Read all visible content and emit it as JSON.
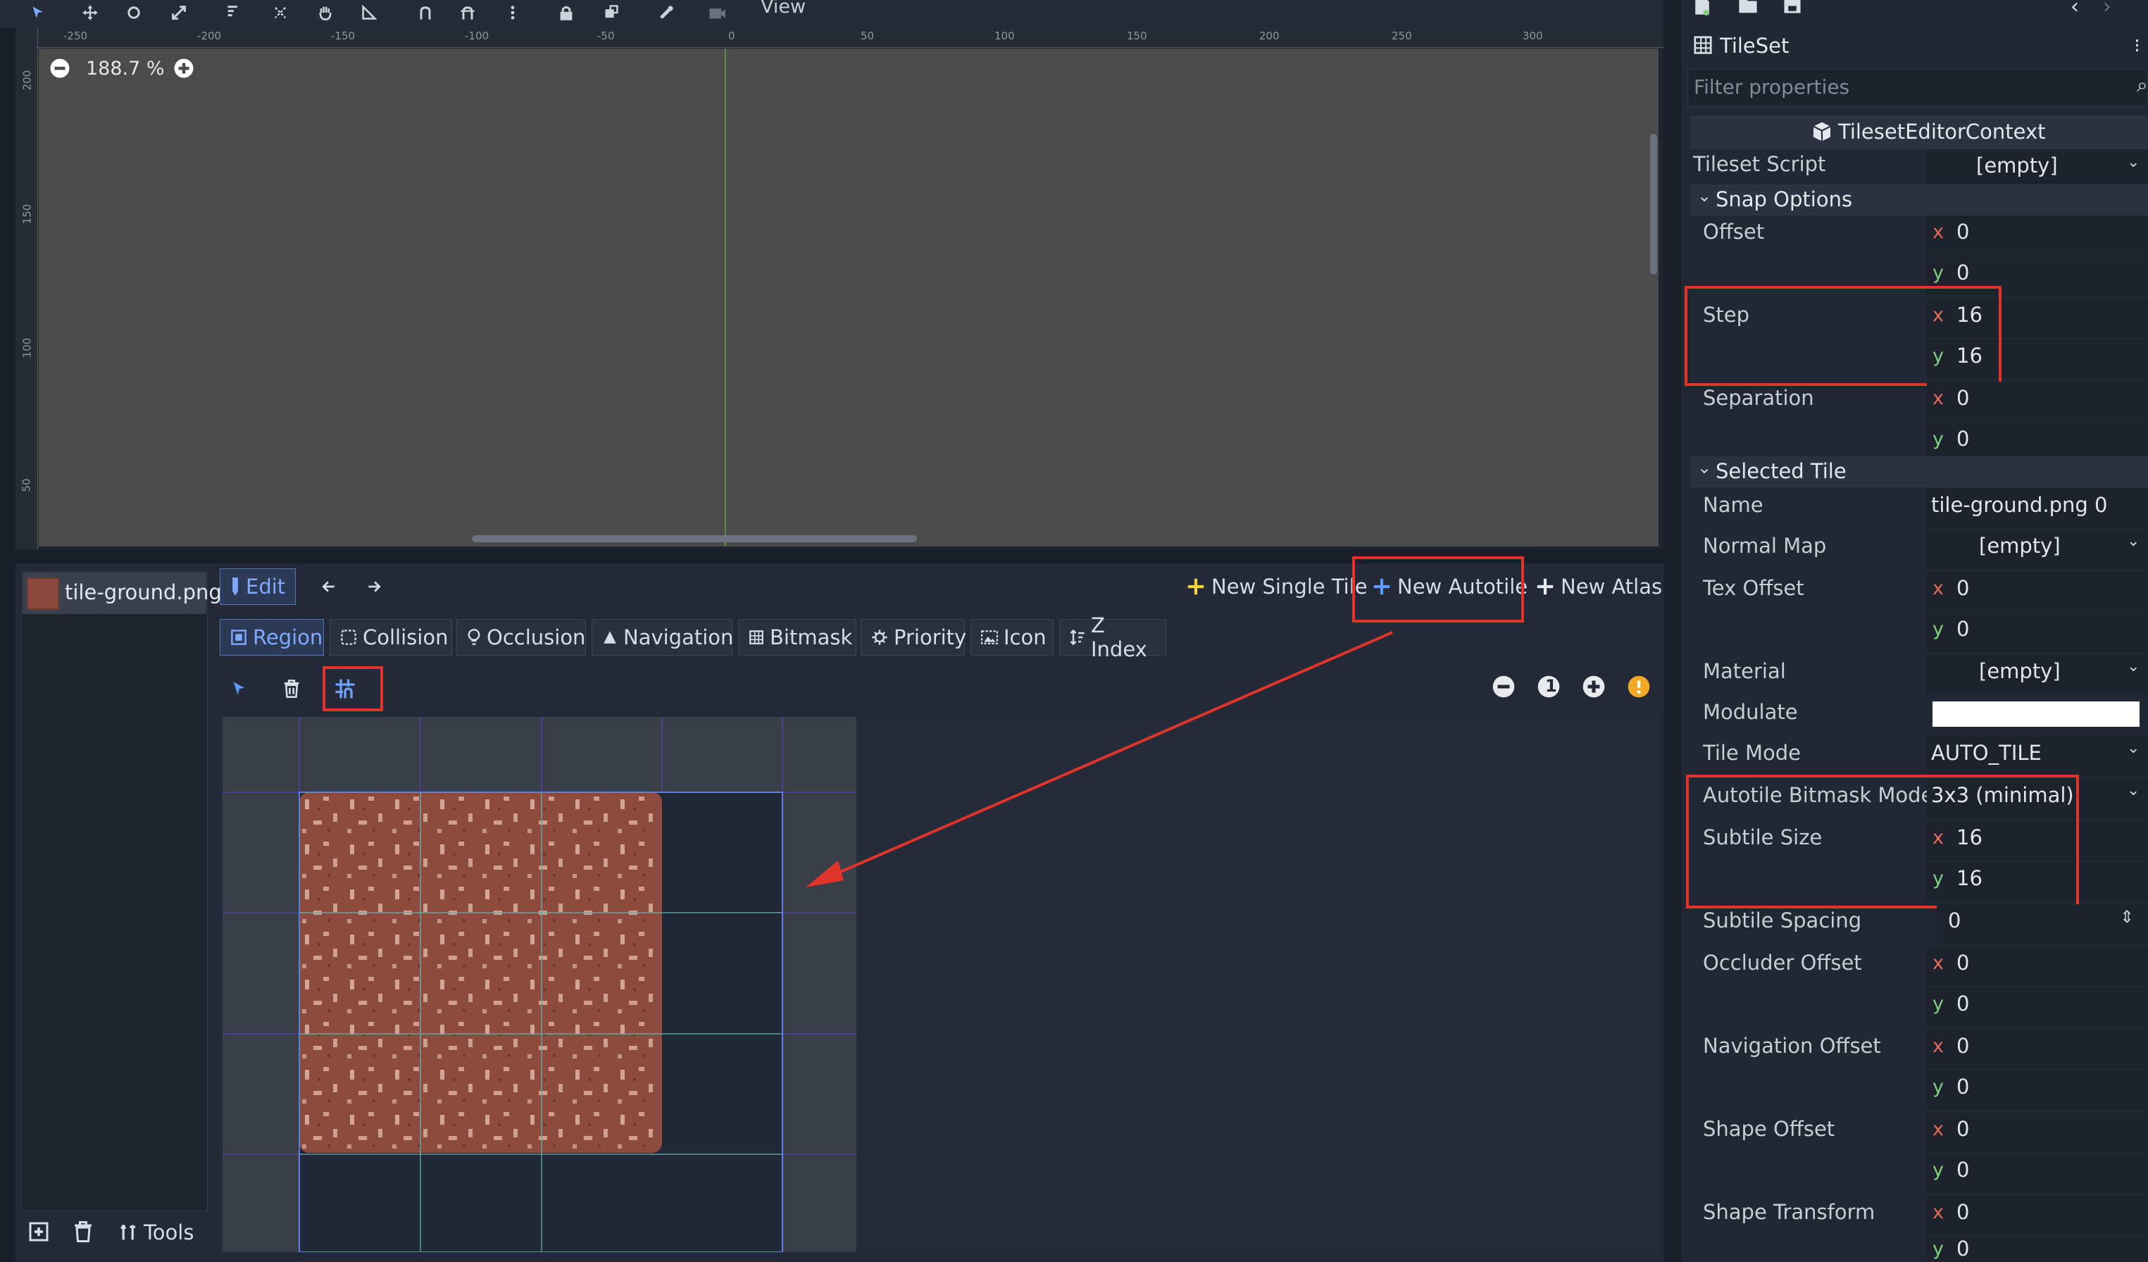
{
  "viewport": {
    "view_menu": "View",
    "zoom": "188.7 %",
    "ruler_h": [
      "-250",
      "-200",
      "-150",
      "-100",
      "-50",
      "0",
      "50",
      "100",
      "150",
      "200",
      "250",
      "300"
    ],
    "ruler_v": [
      "200",
      "150",
      "100",
      "50"
    ]
  },
  "tile_list": {
    "item": "tile-ground.png"
  },
  "editor_toolbar": {
    "edit": "Edit",
    "new_single_tile": "New Single Tile",
    "new_autotile": "New Autotile",
    "new_atlas": "New Atlas"
  },
  "tabs": [
    "Region",
    "Collision",
    "Occlusion",
    "Navigation",
    "Bitmask",
    "Priority",
    "Icon",
    "Z Index"
  ],
  "zoom_controls": {
    "reset": "1"
  },
  "bottom_tools": {
    "tools": "Tools"
  },
  "inspector": {
    "title": "TileSet",
    "filter_placeholder": "Filter properties",
    "context": "TilesetEditorContext",
    "tileset_script": {
      "label": "Tileset Script",
      "value": "[empty]"
    },
    "snap_section": "Snap Options",
    "offset": {
      "label": "Offset",
      "x": "0",
      "y": "0"
    },
    "step": {
      "label": "Step",
      "x": "16",
      "y": "16"
    },
    "separation": {
      "label": "Separation",
      "x": "0",
      "y": "0"
    },
    "selected_section": "Selected Tile",
    "name": {
      "label": "Name",
      "value": "tile-ground.png 0"
    },
    "normal_map": {
      "label": "Normal Map",
      "value": "[empty]"
    },
    "tex_offset": {
      "label": "Tex Offset",
      "x": "0",
      "y": "0"
    },
    "material": {
      "label": "Material",
      "value": "[empty]"
    },
    "modulate": {
      "label": "Modulate",
      "color": "#ffffff"
    },
    "tile_mode": {
      "label": "Tile Mode",
      "value": "AUTO_TILE"
    },
    "bitmask_mode": {
      "label": "Autotile Bitmask Mode",
      "value": "3x3 (minimal)"
    },
    "subtile_size": {
      "label": "Subtile Size",
      "x": "16",
      "y": "16"
    },
    "subtile_spacing": {
      "label": "Subtile Spacing",
      "value": "0"
    },
    "occluder_offset": {
      "label": "Occluder Offset",
      "x": "0",
      "y": "0"
    },
    "navigation_offset": {
      "label": "Navigation Offset",
      "x": "0",
      "y": "0"
    },
    "shape_offset": {
      "label": "Shape Offset",
      "x": "0",
      "y": "0"
    },
    "shape_transform": {
      "label": "Shape Transform",
      "x": "0",
      "y": "0"
    }
  },
  "colors": {
    "accent": "#4f74c4",
    "annotation": "#e0342b",
    "axis_x": "#e46b5a",
    "axis_y": "#7fd17d"
  }
}
